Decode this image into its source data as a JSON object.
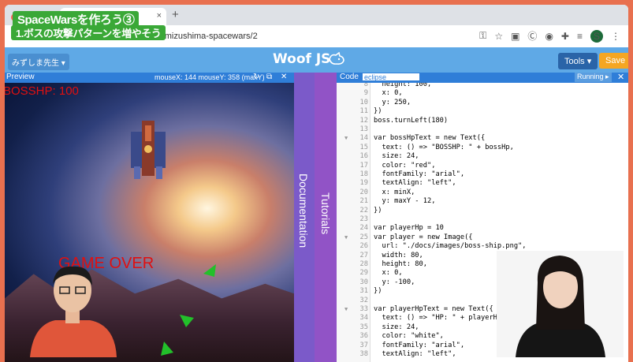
{
  "browser": {
    "tab_close": "×",
    "new_tab": "+",
    "url": "ml#mizushima-spacewars/2",
    "avatar_letter": "S",
    "nav_back": "←",
    "nav_forward": "→",
    "nav_reload": "↻"
  },
  "overlay": {
    "title": "SpaceWarsを作ろう③",
    "subtitle": "1.ボスの攻撃パターンを増やそう"
  },
  "app": {
    "user_menu": "みずしま先生 ▾",
    "logo": "Woof JS",
    "tools": "Tools ▾",
    "save": "Save"
  },
  "preview": {
    "label": "Preview",
    "mouse": "mouseX: 144  mouseY: 358 (maxY)",
    "boss_hp": "BOSSHP: 100",
    "game_over": "GAME OVER"
  },
  "side_tabs": {
    "documentation": "Documentation",
    "tutorials": "Tutorials"
  },
  "editor": {
    "label": "Code",
    "theme": "eclipse",
    "running": "Running ▸",
    "close": "✕",
    "lines": [
      {
        "n": "8",
        "t": "  height: 100,"
      },
      {
        "n": "9",
        "t": "  x: 0,"
      },
      {
        "n": "10",
        "t": "  y: 250,"
      },
      {
        "n": "11",
        "t": "})"
      },
      {
        "n": "12",
        "t": "boss.turnLeft(180)"
      },
      {
        "n": "13",
        "t": ""
      },
      {
        "n": "14",
        "t": "var bossHpText = new Text({",
        "fold": true
      },
      {
        "n": "15",
        "t": "  text: () => \"BOSSHP: \" + bossHp,"
      },
      {
        "n": "16",
        "t": "  size: 24,"
      },
      {
        "n": "17",
        "t": "  color: \"red\","
      },
      {
        "n": "18",
        "t": "  fontFamily: \"arial\","
      },
      {
        "n": "19",
        "t": "  textAlign: \"left\","
      },
      {
        "n": "20",
        "t": "  x: minX,"
      },
      {
        "n": "21",
        "t": "  y: maxY - 12,"
      },
      {
        "n": "22",
        "t": "})"
      },
      {
        "n": "23",
        "t": ""
      },
      {
        "n": "24",
        "t": "var playerHp = 10"
      },
      {
        "n": "25",
        "t": "var player = new Image({",
        "fold": true
      },
      {
        "n": "26",
        "t": "  url: \"./docs/images/boss-ship.png\","
      },
      {
        "n": "27",
        "t": "  width: 80,"
      },
      {
        "n": "28",
        "t": "  height: 80,"
      },
      {
        "n": "29",
        "t": "  x: 0,"
      },
      {
        "n": "30",
        "t": "  y: -100,"
      },
      {
        "n": "31",
        "t": "})"
      },
      {
        "n": "32",
        "t": ""
      },
      {
        "n": "33",
        "t": "var playerHpText = new Text({",
        "fold": true
      },
      {
        "n": "34",
        "t": "  text: () => \"HP: \" + playerHp,"
      },
      {
        "n": "35",
        "t": "  size: 24,"
      },
      {
        "n": "36",
        "t": "  color: \"white\","
      },
      {
        "n": "37",
        "t": "  fontFamily: \"arial\","
      },
      {
        "n": "38",
        "t": "  textAlign: \"left\","
      }
    ]
  }
}
